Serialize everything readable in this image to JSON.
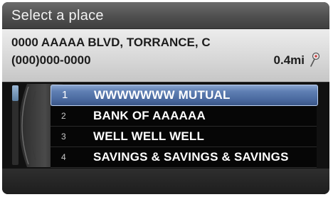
{
  "title": "Select a place",
  "place": {
    "address": "0000 AAAAA BLVD, TORRANCE, C",
    "phone": "(000)000-0000",
    "distance": "0.4mi",
    "pin_icon": "map-pin-icon"
  },
  "list": {
    "items": [
      {
        "number": "1",
        "label": "WWWWWWW MUTUAL",
        "selected": true
      },
      {
        "number": "2",
        "label": "BANK OF AAAAAA",
        "selected": false
      },
      {
        "number": "3",
        "label": "WELL WELL WELL",
        "selected": false
      },
      {
        "number": "4",
        "label": "SAVINGS & SAVINGS & SAVINGS",
        "selected": false
      }
    ]
  },
  "colors": {
    "highlight": "#5f7fb3",
    "title_bar": "#5a5a5a",
    "info_panel": "#d8d8d8"
  }
}
